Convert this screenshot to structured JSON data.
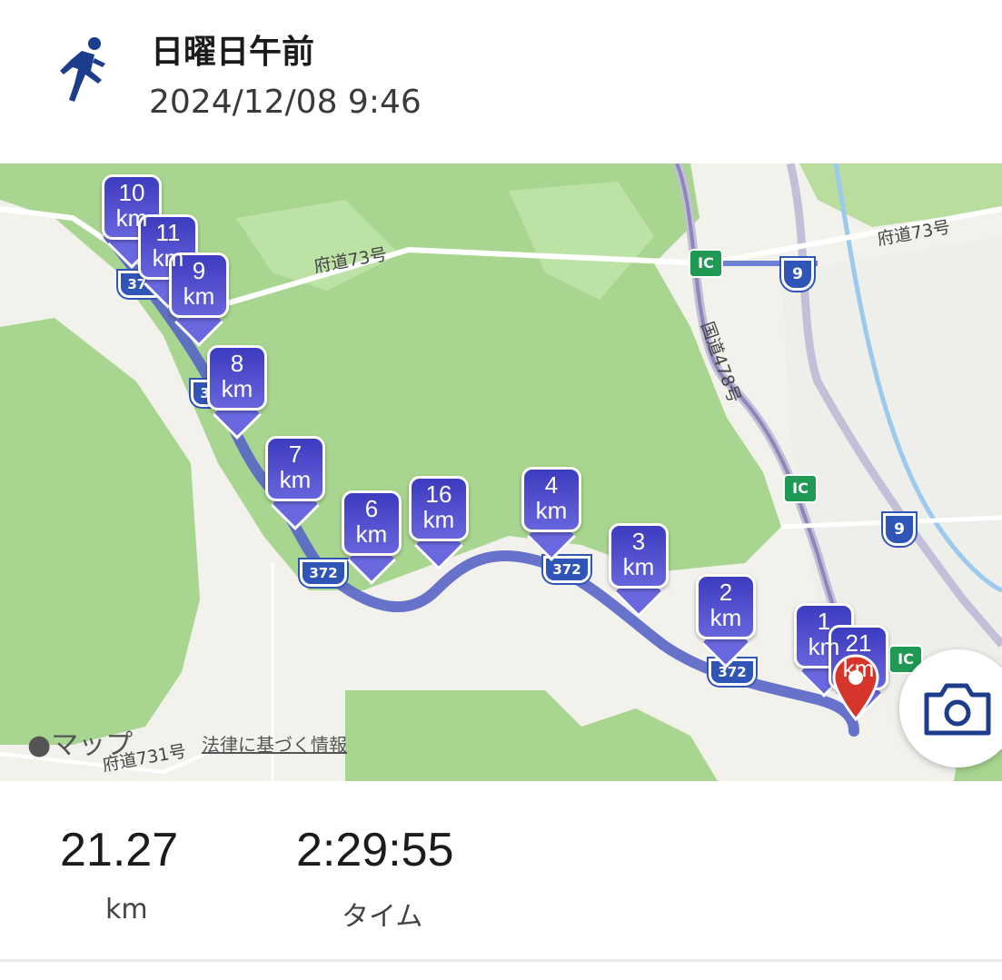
{
  "header": {
    "icon": "running-person-icon",
    "title": "日曜日午前",
    "datetime": "2024/12/08 9:46"
  },
  "map": {
    "road_labels": [
      "府道73号",
      "府道73号",
      "国道478号",
      "府道731号"
    ],
    "shields": [
      "9",
      "9",
      "372",
      "372",
      "372",
      "372",
      "372"
    ],
    "ic_label": "IC",
    "km_markers": [
      "10",
      "11",
      "9",
      "8",
      "7",
      "6",
      "16",
      "4",
      "3",
      "2",
      "1",
      "21"
    ],
    "km_unit": "km",
    "attribution": "マップ",
    "legal_link": "法律に基づく情報",
    "route_color": "#5060c8",
    "marker_color": "#4a48c9",
    "destination_pin_color": "#d6352b",
    "camera_icon": "camera-icon"
  },
  "stats": {
    "distance_value": "21.27",
    "distance_label": "km",
    "time_value": "2:29:55",
    "time_label": "タイム"
  }
}
